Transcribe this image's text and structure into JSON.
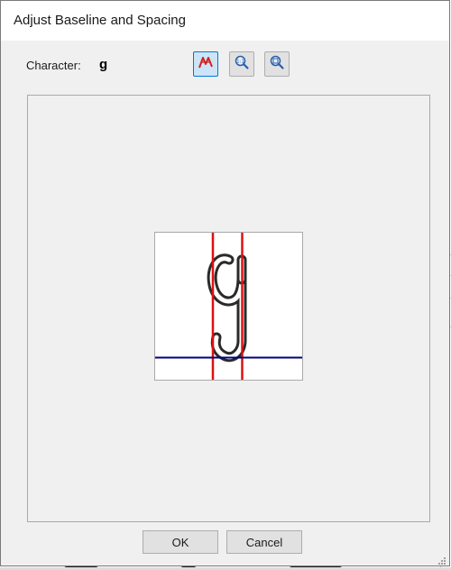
{
  "dialog": {
    "title": "Adjust Baseline and Spacing"
  },
  "character": {
    "label": "Character:",
    "value": "g"
  },
  "toolbar": {
    "buttons": [
      {
        "icon": "baseline-adjust-icon",
        "active": true
      },
      {
        "icon": "zoom-actual-size-icon",
        "active": false
      },
      {
        "icon": "zoom-fit-icon",
        "active": false
      }
    ]
  },
  "buttons": {
    "ok": "OK",
    "cancel": "Cancel"
  },
  "background": {
    "fragments": [
      "\\",
      "s",
      "d",
      "y",
      "s"
    ]
  },
  "colors": {
    "spacing_line": "#e01010",
    "baseline": "#000080",
    "active_button_bg": "#cce4f7",
    "active_button_border": "#0078d7"
  }
}
